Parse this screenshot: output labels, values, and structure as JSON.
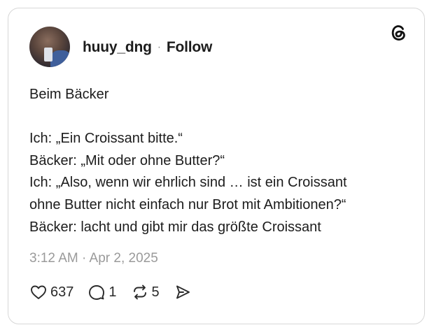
{
  "post": {
    "username": "huuy_dng",
    "separator": "·",
    "follow_label": "Follow",
    "lines": [
      "Beim Bäcker",
      "",
      "Ich: „Ein Croissant bitte.“",
      "Bäcker: „Mit oder ohne Butter?“",
      "Ich: „Also, wenn wir ehrlich sind … ist ein Croissant",
      "ohne Butter nicht einfach nur Brot mit Ambitionen?“",
      "Bäcker: lacht und gibt mir das größte Croissant"
    ],
    "timestamp": "3:12 AM · Apr 2, 2025"
  },
  "actions": {
    "likes": "637",
    "replies": "1",
    "reposts": "5"
  },
  "icons": {
    "brand": "threads-icon",
    "like": "heart-icon",
    "reply": "comment-icon",
    "repost": "repost-icon",
    "share": "send-icon"
  }
}
